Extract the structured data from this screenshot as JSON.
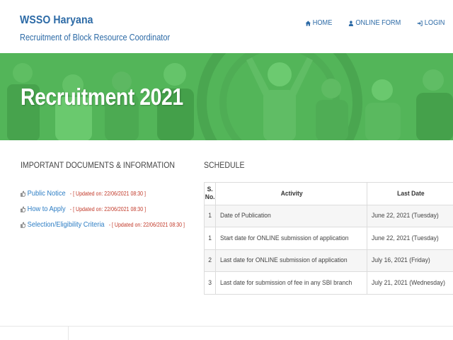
{
  "header": {
    "title": "WSSO Haryana",
    "subtitle": "Recruitment of Block Resource Coordinator"
  },
  "nav": {
    "home": {
      "label": "HOME",
      "icon": "home-icon"
    },
    "online_form": {
      "label": "ONLINE FORM",
      "icon": "user-icon"
    },
    "login": {
      "label": "LOGIN",
      "icon": "login-icon"
    }
  },
  "banner": {
    "title": "Recruitment 2021"
  },
  "documents": {
    "heading": "IMPORTANT DOCUMENTS & INFORMATION",
    "items": [
      {
        "label": "Public Notice",
        "updated": "- [ Updated on: 22/06/2021 08:30 ]",
        "icon": "thumbs-up-icon"
      },
      {
        "label": "How to Apply",
        "updated": "- [ Updated on: 22/06/2021 08:30 ]",
        "icon": "thumbs-up-icon"
      },
      {
        "label": "Selection/Eligibility Criteria",
        "updated": "- [ Updated on: 22/06/2021 08:30 ]",
        "icon": "thumbs-up-icon"
      }
    ]
  },
  "schedule": {
    "heading": "SCHEDULE",
    "columns": [
      "S. No.",
      "Activity",
      "Last Date"
    ],
    "rows": [
      {
        "sno": "1",
        "activity": "Date of Publication",
        "date": "June 22, 2021 (Tuesday)"
      },
      {
        "sno": "1",
        "activity": "Start date for ONLINE submission of application",
        "date": "June 22, 2021 (Tuesday)"
      },
      {
        "sno": "2",
        "activity": "Last date for ONLINE submission of application",
        "date": "July 16, 2021 (Friday)"
      },
      {
        "sno": "3",
        "activity": "Last date for submission of fee in any SBI branch",
        "date": "July 21, 2021 (Wednesday)"
      }
    ]
  },
  "colors": {
    "brand_blue": "#2c6aa6",
    "banner_green": "#54b55a",
    "link_blue": "#2c7dc4",
    "updated_red": "#c23a2a"
  }
}
